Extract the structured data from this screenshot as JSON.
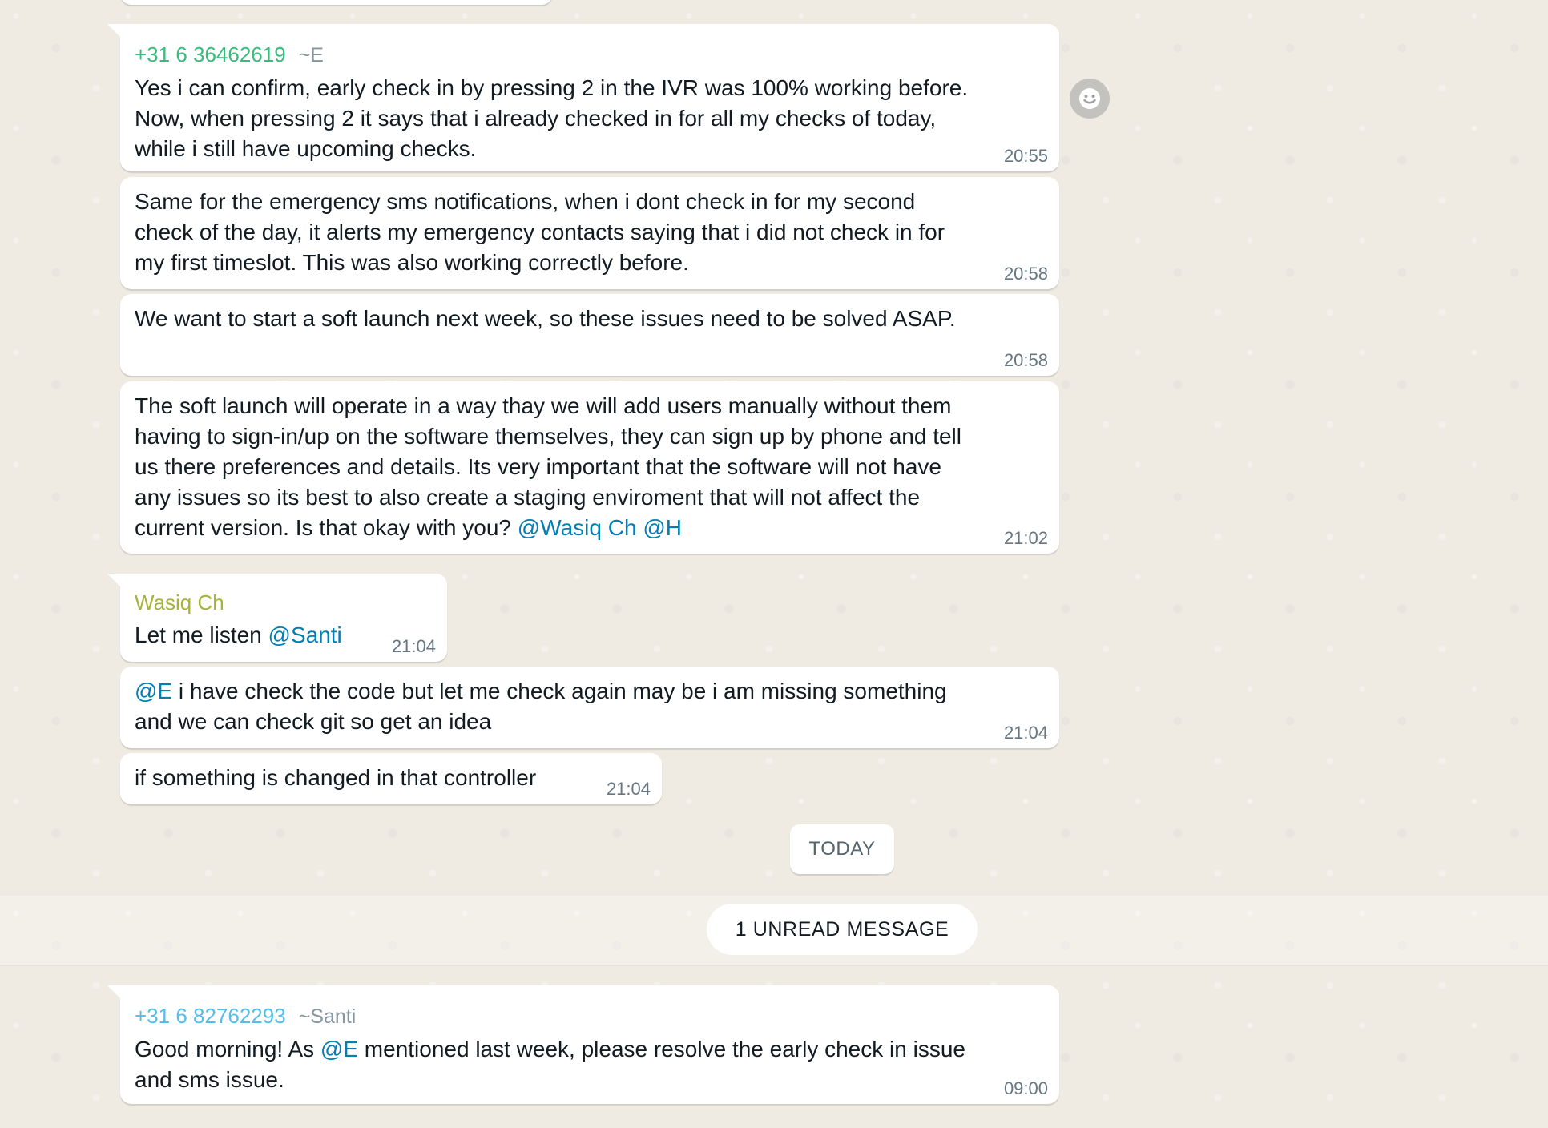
{
  "messages": [
    {
      "sender_phone": "+31 6 36462619",
      "sender_alias": "~E",
      "text": "Yes i can confirm, early check in by pressing 2 in the IVR was 100% working before. Now, when pressing 2 it says that i already checked in for all my checks of today, while i still have upcoming checks.",
      "time": "20:55"
    },
    {
      "text": "Same for the emergency sms notifications, when i dont check in for my second check of the day, it alerts my emergency contacts saying that i did not check in for my first timeslot. This was also working correctly before.",
      "time": "20:58"
    },
    {
      "text": "We want to start a soft launch next week, so these issues need to be solved ASAP.",
      "time": "20:58"
    },
    {
      "text": "The soft launch will operate in a way thay we will add users manually without them having to sign-in/up on the software themselves, they can sign up by phone and tell us there preferences and details. Its very important that the software will not have any issues so its best to also create a staging enviroment that will not affect the current version. Is that okay with you?",
      "mention_1": "@Wasiq Ch",
      "mention_2": "@H",
      "time": "21:02"
    },
    {
      "sender_name": "Wasiq Ch",
      "text": "Let me listen",
      "mention": "@Santi",
      "time": "21:04"
    },
    {
      "mention": "@E",
      "text": "i have check the code but let me check again may be i am missing something and we can check git so get an idea",
      "time": "21:04"
    },
    {
      "text": "if something is changed in that controller",
      "time": "21:04"
    },
    {
      "sender_phone": "+31 6 82762293",
      "sender_alias": "~Santi",
      "text_before": "Good morning! As",
      "mention": "@E",
      "text_after": "mentioned last week, please resolve the early check in issue and sms issue.",
      "time": "09:00"
    }
  ],
  "date_divider": "TODAY",
  "unread_divider": "1 UNREAD MESSAGE",
  "icons": {
    "reaction": "emoji-smile-icon"
  },
  "colors": {
    "background": "#efeae2",
    "bubble": "#ffffff",
    "mention": "#027eb5",
    "sender_green": "#35bd7b",
    "sender_olive": "#a5b337",
    "sender_blue": "#53bdeb"
  }
}
